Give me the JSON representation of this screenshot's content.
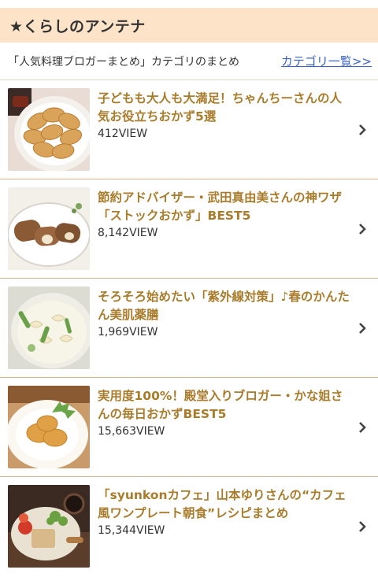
{
  "header": {
    "title": "★くらしのアンテナ"
  },
  "subheader": {
    "text": "「人気料理ブロガーまとめ」カテゴリのまとめ",
    "link_label": "カテゴリ一覧>>"
  },
  "items": [
    {
      "title": "子どもも大人も大満足！ちゃんちーさんの人気お役立ちおかず5選",
      "views": "412VIEW",
      "thumb_icon": "gyoza-photo"
    },
    {
      "title": "節約アドバイザー・武田真由美さんの神ワザ「ストックおかず」BEST5",
      "views": "8,142VIEW",
      "thumb_icon": "meat-roll-photo"
    },
    {
      "title": "そろそろ始めたい「紫外線対策」♪春のかんたん美肌薬膳",
      "views": "1,969VIEW",
      "thumb_icon": "pasta-soup-photo"
    },
    {
      "title": "実用度100%！殿堂入りブロガー・かな姐さんの毎日おかずBEST5",
      "views": "15,663VIEW",
      "thumb_icon": "fried-chicken-photo"
    },
    {
      "title": "「syunkonカフェ」山本ゆりさんの“カフェ風ワンプレート朝食”レシピまとめ",
      "views": "15,344VIEW",
      "thumb_icon": "cafe-plate-photo"
    }
  ],
  "colors": {
    "header_bg": "#fde3c8",
    "title_color": "#a97c2c",
    "link_color": "#3a63c7",
    "divider": "#d7b88e"
  }
}
